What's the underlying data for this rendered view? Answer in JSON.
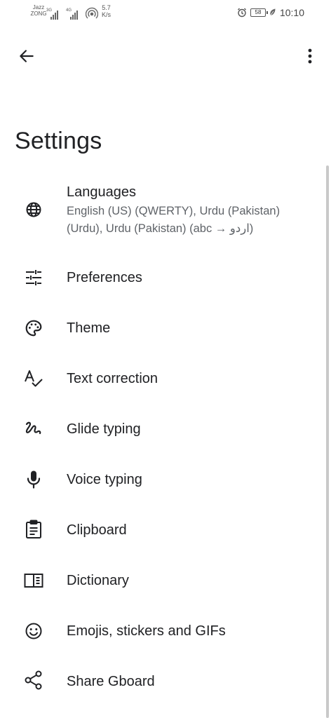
{
  "status_bar": {
    "carrier_1": "Jazz",
    "carrier_2": "ZONG",
    "sim1_tag": "3G",
    "sim2_tag": "4G",
    "wifi_tag": "1",
    "speed_value": "5.7",
    "speed_unit": "K/s",
    "battery": "58",
    "time": "10:10"
  },
  "page": {
    "title": "Settings"
  },
  "items": [
    {
      "label": "Languages",
      "sublabel_line1": "English (US) (QWERTY), Urdu (Pakistan)",
      "sublabel_line2": "(Urdu), Urdu (Pakistan) (abc → اردو)",
      "icon": "globe-icon"
    },
    {
      "label": "Preferences",
      "icon": "tune-icon"
    },
    {
      "label": "Theme",
      "icon": "palette-icon"
    },
    {
      "label": "Text correction",
      "icon": "spellcheck-icon"
    },
    {
      "label": "Glide typing",
      "icon": "gesture-icon"
    },
    {
      "label": "Voice typing",
      "icon": "mic-icon"
    },
    {
      "label": "Clipboard",
      "icon": "clipboard-icon"
    },
    {
      "label": "Dictionary",
      "icon": "book-icon"
    },
    {
      "label": "Emojis, stickers and GIFs",
      "icon": "emoji-icon"
    },
    {
      "label": "Share Gboard",
      "icon": "share-icon"
    }
  ]
}
